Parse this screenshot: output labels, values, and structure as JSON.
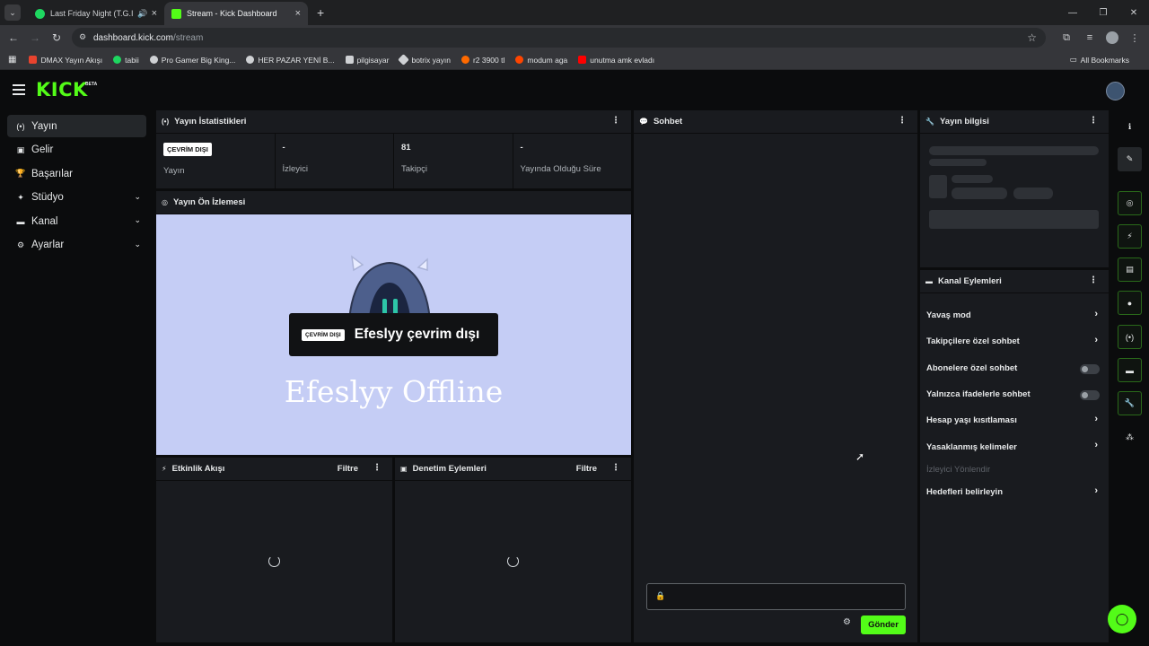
{
  "browser": {
    "tabs": [
      {
        "title": "Last Friday Night (T.G.I.F.) -",
        "favicon_color": "#1ed760"
      },
      {
        "title": "Stream - Kick Dashboard",
        "favicon_color": "#53fc18"
      }
    ],
    "url_host": "dashboard.kick.com",
    "url_path": "/stream",
    "bookmarks": [
      {
        "label": "DMAX Yayın Akışı",
        "color": "#e8432e"
      },
      {
        "label": "tabii",
        "color": "#1ed760"
      },
      {
        "label": "Pro Gamer Big King...",
        "color": "#cfd1d4"
      },
      {
        "label": "HER PAZAR YENİ B...",
        "color": "#cfd1d4"
      },
      {
        "label": "pilgisayar",
        "color": "#cfd1d4"
      },
      {
        "label": "botrix yayın",
        "color": "#cfd1d4"
      },
      {
        "label": "r2 3900 tl",
        "color": "#ff6a00"
      },
      {
        "label": "modum aga",
        "color": "#ff4500"
      },
      {
        "label": "unutma amk evladı",
        "color": "#ff0000"
      }
    ],
    "all_bookmarks": "All Bookmarks"
  },
  "app": {
    "logo": "KICK",
    "logo_badge": "BETA",
    "accent": "#53fc18"
  },
  "sidebar": {
    "items": [
      {
        "label": "Yayın",
        "icon": "broadcast-icon"
      },
      {
        "label": "Gelir",
        "icon": "revenue-icon"
      },
      {
        "label": "Başarılar",
        "icon": "trophy-icon"
      },
      {
        "label": "Stüdyo",
        "icon": "studio-icon"
      },
      {
        "label": "Kanal",
        "icon": "channel-icon"
      },
      {
        "label": "Ayarlar",
        "icon": "gear-icon"
      }
    ]
  },
  "stats_panel": {
    "title": "Yayın İstatistikleri",
    "status_badge": "ÇEVRİM DIŞI",
    "items": [
      {
        "value": "",
        "label": "Yayın"
      },
      {
        "value": "-",
        "label": "İzleyici"
      },
      {
        "value": "81",
        "label": "Takipçi"
      },
      {
        "value": "-",
        "label": "Yayında Olduğu Süre"
      }
    ]
  },
  "preview_panel": {
    "title": "Yayın Ön İzlemesi",
    "badge": "ÇEVRİM DIŞI",
    "offline_text": "Efeslyy çevrim dışı",
    "banner_text": "Efeslyy Offline"
  },
  "activity_panel": {
    "title": "Etkinlik Akışı",
    "filter": "Filtre"
  },
  "moderation_panel": {
    "title": "Denetim Eylemleri",
    "filter": "Filtre"
  },
  "chat_panel": {
    "title": "Sohbet",
    "send": "Gönder"
  },
  "info_panel": {
    "title": "Yayın bilgisi"
  },
  "channel_actions": {
    "title": "Kanal Eylemleri",
    "items": [
      {
        "label": "Yavaş mod",
        "kind": "arrow"
      },
      {
        "label": "Takipçilere özel sohbet",
        "kind": "arrow"
      },
      {
        "label": "Abonelere özel sohbet",
        "kind": "toggle"
      },
      {
        "label": "Yalnızca ifadelerle sohbet",
        "kind": "toggle"
      },
      {
        "label": "Hesap yaşı kısıtlaması",
        "kind": "arrow"
      },
      {
        "label": "Yasaklanmış kelimeler",
        "kind": "arrow"
      },
      {
        "label": "İzleyici Yönlendir",
        "kind": "disabled"
      },
      {
        "label": "Hedefleri belirleyin",
        "kind": "arrow"
      }
    ]
  }
}
